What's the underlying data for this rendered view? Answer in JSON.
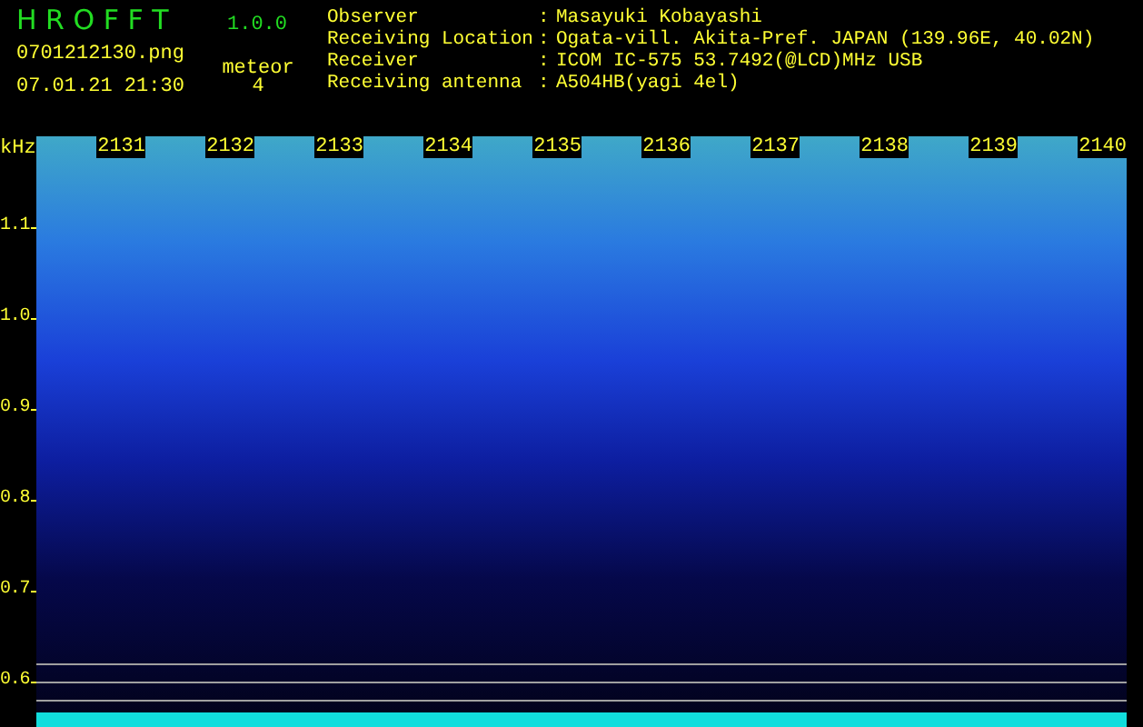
{
  "app": {
    "name": "H R O F F T",
    "version": "1.0.0"
  },
  "file": {
    "name": "0701212130.png",
    "datetime": "07.01.21 21:30"
  },
  "meteor": {
    "label": "meteor",
    "count": "4"
  },
  "station_info": [
    {
      "label": "Observer",
      "separator": ":",
      "value": "Masayuki Kobayashi"
    },
    {
      "label": "Receiving Location",
      "separator": ":",
      "value": "Ogata-vill. Akita-Pref. JAPAN (139.96E, 40.02N)"
    },
    {
      "label": "Receiver",
      "separator": ":",
      "value": "ICOM IC-575 53.7492(@LCD)MHz USB"
    },
    {
      "label": "Receiving antenna",
      "separator": ":",
      "value": "A504HB(yagi 4el)"
    }
  ],
  "spectrogram": {
    "unit": "kHz",
    "frequency_labels": [
      "1.1",
      "1.0",
      "0.9",
      "0.8",
      "0.7",
      "0.6"
    ],
    "time_labels": [
      "2131",
      "2132",
      "2133",
      "2134",
      "2135",
      "2136",
      "2137",
      "2138",
      "2139",
      "2140"
    ]
  }
}
